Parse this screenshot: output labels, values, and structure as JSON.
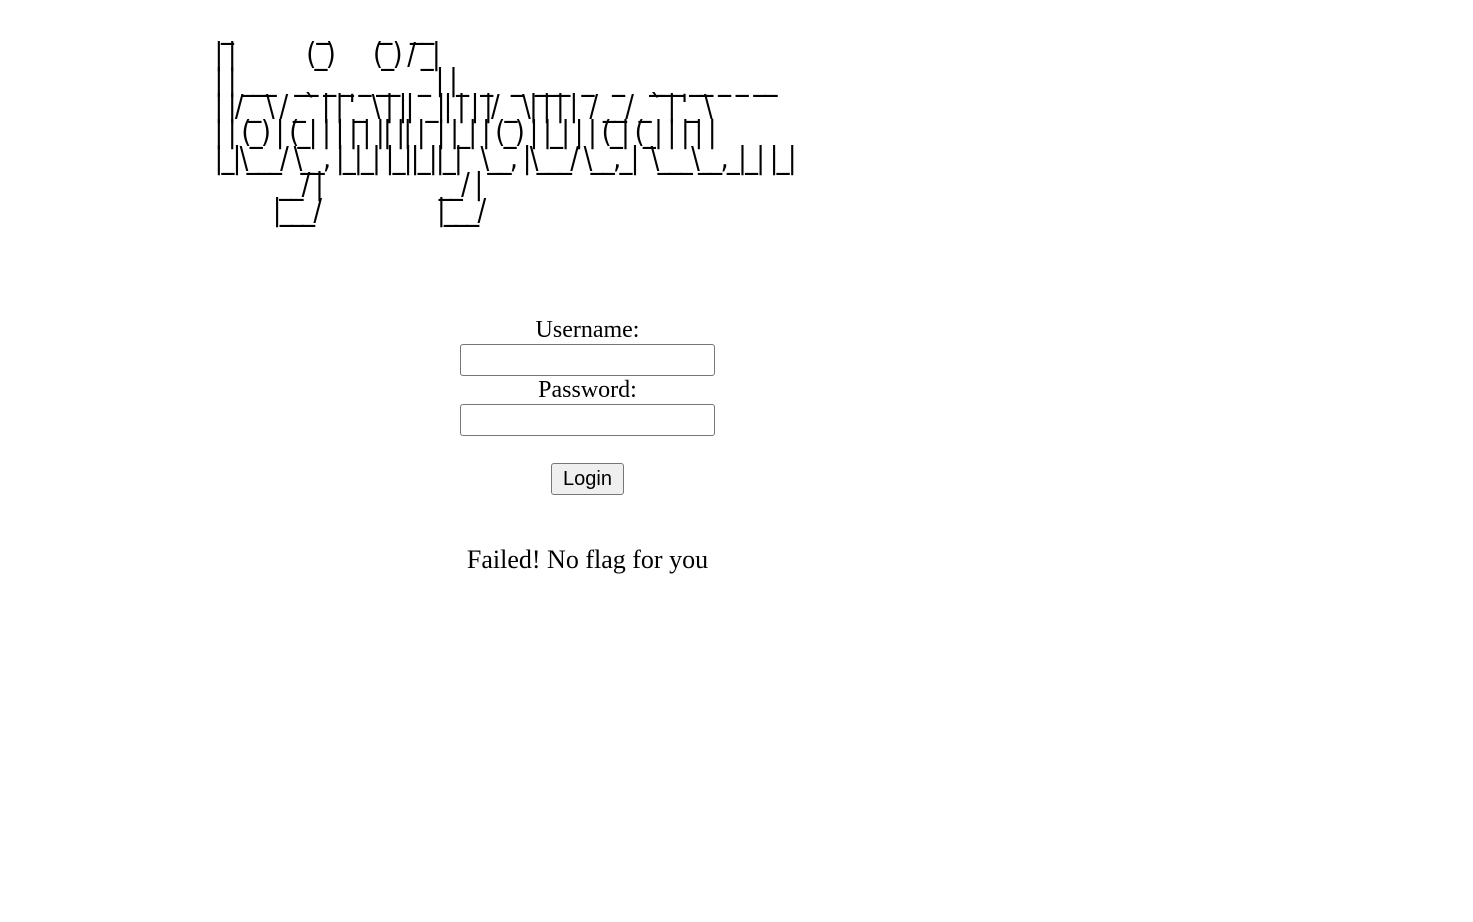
{
  "banner": {
    "ascii_art": "  _             _        _   __                                    \n | |           (_)      (_) / _|                                   \n | | ___   __ _ _ _ __   _ | |_  _   _  ___  _   _    ___ __ _ _ __  \n | |/ _ \\ / _` | | '_ \\ | ||  _|| | | |/ _ \\| | | |  / __/ _` | '_ \\ \n | | (_) | (_| | | | | || || |  | |_| | (_) | |_| | | (_| (_| | | | |\n |_|\\___/ \\__, |_|_| |_||_||_|   \\__, |\\___/ \\__,_|  \\___\\__,_|_| |_|\n           __/ |                  __/ |                              \n          |___/                  |___/                               "
  },
  "form": {
    "username_label": "Username:",
    "username_value": "",
    "password_label": "Password:",
    "password_value": "",
    "login_button_label": "Login"
  },
  "status": {
    "message": "Failed! No flag for you"
  }
}
